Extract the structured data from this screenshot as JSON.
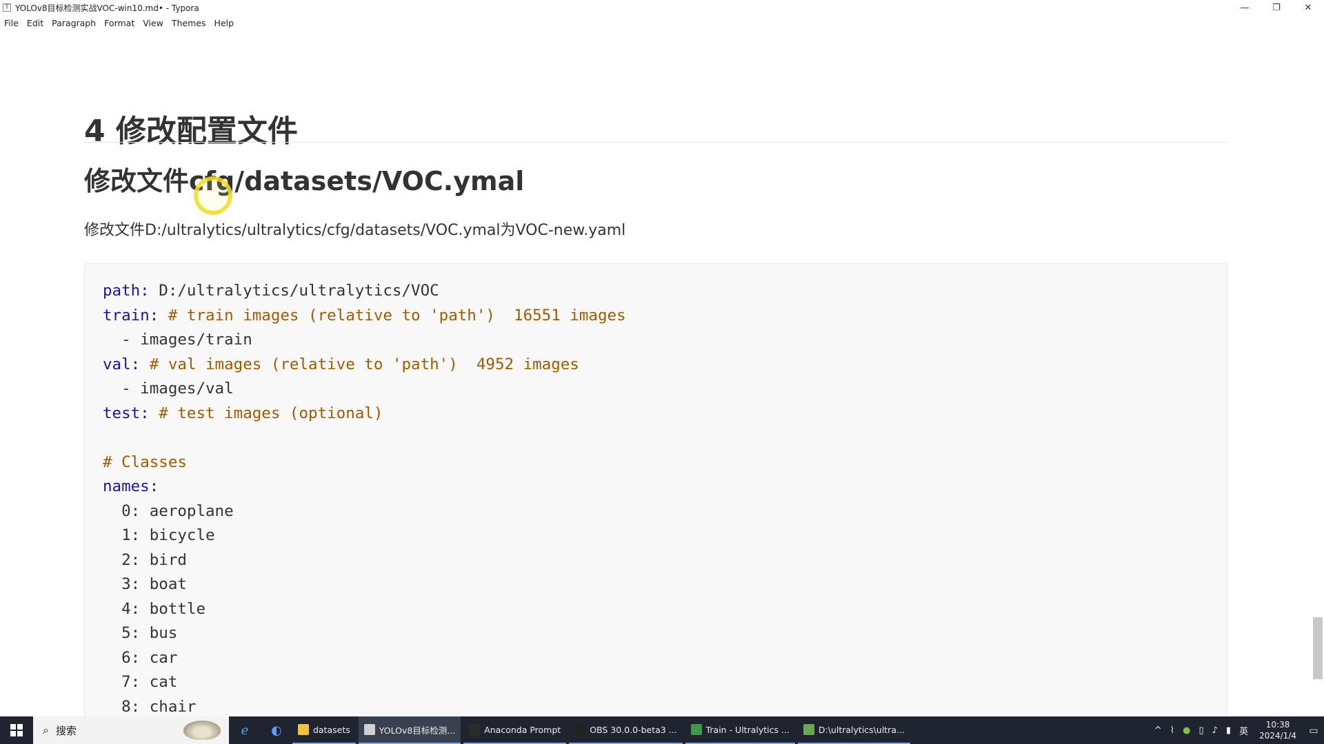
{
  "window": {
    "title": "YOLOv8目标检测实战VOC-win10.md• - Typora",
    "icon_glyph": "T",
    "minimize": "—",
    "restore": "❐",
    "close": "✕"
  },
  "menu": [
    "File",
    "Edit",
    "Paragraph",
    "Format",
    "View",
    "Themes",
    "Help"
  ],
  "document": {
    "h1": "4 修改配置文件",
    "h2": "修改文件cfg/datasets/VOC.ymal",
    "paragraph": "修改文件D:/ultralytics/ultralytics/cfg/datasets/VOC.ymal为VOC-new.yaml",
    "code_lines": [
      {
        "key": "path:",
        "rest": " D:/ultralytics/ultralytics/VOC",
        "comment": ""
      },
      {
        "key": "train:",
        "rest": " ",
        "comment": "# train images (relative to 'path')  16551 images"
      },
      {
        "key": "",
        "rest": "  - images/train",
        "comment": ""
      },
      {
        "key": "val:",
        "rest": " ",
        "comment": "# val images (relative to 'path')  4952 images"
      },
      {
        "key": "",
        "rest": "  - images/val",
        "comment": ""
      },
      {
        "key": "test:",
        "rest": " ",
        "comment": "# test images (optional)"
      },
      {
        "key": "",
        "rest": "",
        "comment": ""
      },
      {
        "key": "",
        "rest": "",
        "comment": "# Classes"
      },
      {
        "key": "names:",
        "rest": "",
        "comment": ""
      },
      {
        "key": "",
        "rest": "  0: aeroplane",
        "comment": ""
      },
      {
        "key": "",
        "rest": "  1: bicycle",
        "comment": ""
      },
      {
        "key": "",
        "rest": "  2: bird",
        "comment": ""
      },
      {
        "key": "",
        "rest": "  3: boat",
        "comment": ""
      },
      {
        "key": "",
        "rest": "  4: bottle",
        "comment": ""
      },
      {
        "key": "",
        "rest": "  5: bus",
        "comment": ""
      },
      {
        "key": "",
        "rest": "  6: car",
        "comment": ""
      },
      {
        "key": "",
        "rest": "  7: cat",
        "comment": ""
      },
      {
        "key": "",
        "rest": "  8: chair",
        "comment": ""
      }
    ]
  },
  "taskbar": {
    "search_glyph": "⌕",
    "search_placeholder": "搜索",
    "apps": [
      {
        "label": "datasets",
        "color": "#f0c040",
        "active": false
      },
      {
        "label": "YOLOv8目标检测...",
        "color": "#d0d0d0",
        "active": true
      },
      {
        "label": "Anaconda Prompt",
        "color": "#2b2b2b",
        "active": false
      },
      {
        "label": "OBS 30.0.0-beta3 ...",
        "color": "#222222",
        "active": false
      },
      {
        "label": "Train - Ultralytics ...",
        "color": "#3c9a4a",
        "active": false
      },
      {
        "label": "D:\\ultralytics\\ultra...",
        "color": "#6aa84f",
        "active": false
      }
    ],
    "tray_chevron": "^",
    "tray_lang": "英",
    "time": "10:38",
    "date": "2024/1/4",
    "notify_glyph": "▭"
  },
  "colors": {
    "code_key": "#221199",
    "code_comment": "#a05a00",
    "taskbar_bg": "#1f2430"
  }
}
